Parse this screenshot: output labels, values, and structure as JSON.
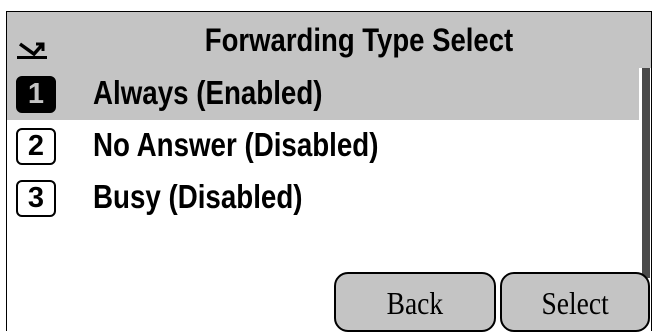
{
  "header": {
    "title": "Forwarding Type Select",
    "icon": "call-forward-icon"
  },
  "menu": {
    "items": [
      {
        "number": "1",
        "label": "Always (Enabled)",
        "selected": true
      },
      {
        "number": "2",
        "label": "No Answer (Disabled)",
        "selected": false
      },
      {
        "number": "3",
        "label": "Busy (Disabled)",
        "selected": false
      }
    ]
  },
  "softkeys": {
    "back_label": "Back",
    "select_label": "Select"
  },
  "colors": {
    "highlight": "#c4c4c4",
    "text": "#000000",
    "background": "#ffffff"
  }
}
